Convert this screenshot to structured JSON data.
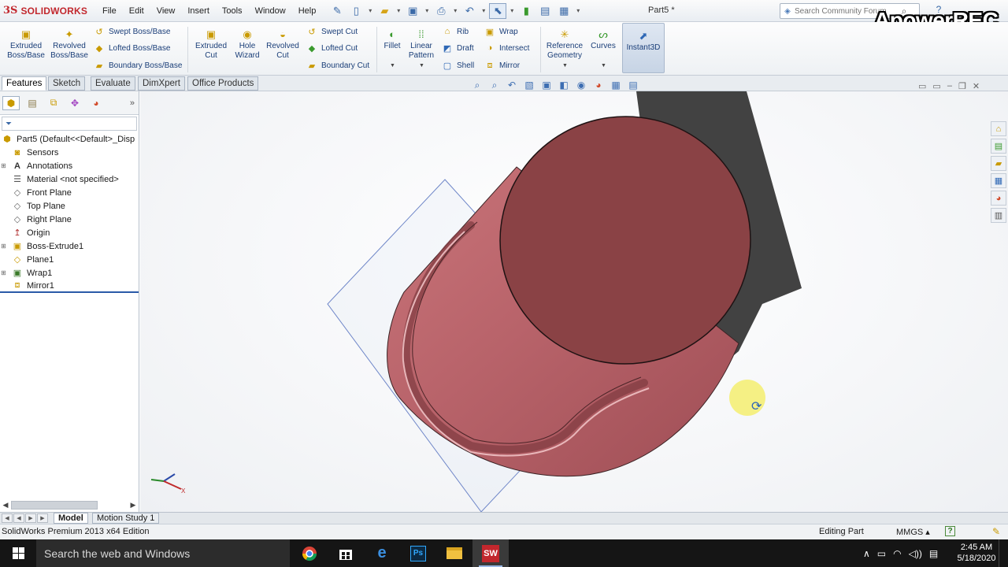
{
  "app": {
    "logo_ds": "3S",
    "logo_name": "SOLIDWORKS",
    "document_title": "Part5 *",
    "recorder_watermark": "ApowerREC s"
  },
  "menus": [
    "File",
    "Edit",
    "View",
    "Insert",
    "Tools",
    "Window",
    "Help"
  ],
  "search": {
    "placeholder": "Search Community Forum"
  },
  "ribbon": {
    "extruded_boss": "Extruded Boss/Base",
    "revolved_boss": "Revolved Boss/Base",
    "swept_boss": "Swept Boss/Base",
    "lofted_boss": "Lofted Boss/Base",
    "boundary_boss": "Boundary Boss/Base",
    "extruded_cut": "Extruded Cut",
    "hole_wizard": "Hole Wizard",
    "revolved_cut": "Revolved Cut",
    "swept_cut": "Swept Cut",
    "lofted_cut": "Lofted Cut",
    "boundary_cut": "Boundary Cut",
    "fillet": "Fillet",
    "linear_pattern": "Linear Pattern",
    "rib": "Rib",
    "draft": "Draft",
    "shell": "Shell",
    "wrap": "Wrap",
    "intersect": "Intersect",
    "mirror": "Mirror",
    "reference_geometry": "Reference Geometry",
    "curves": "Curves",
    "instant3d": "Instant3D"
  },
  "tabs": [
    "Features",
    "Sketch",
    "Evaluate",
    "DimXpert",
    "Office Products"
  ],
  "active_tab": "Features",
  "feature_tree": {
    "root": "Part5  (Default<<Default>_Disp",
    "items": [
      {
        "label": "Sensors",
        "icon": "sensor-icon",
        "expandable": false
      },
      {
        "label": "Annotations",
        "icon": "annotation-icon",
        "expandable": true
      },
      {
        "label": "Material <not specified>",
        "icon": "material-icon",
        "expandable": false
      },
      {
        "label": "Front Plane",
        "icon": "plane-icon",
        "expandable": false
      },
      {
        "label": "Top Plane",
        "icon": "plane-icon",
        "expandable": false
      },
      {
        "label": "Right Plane",
        "icon": "plane-icon",
        "expandable": false
      },
      {
        "label": "Origin",
        "icon": "origin-icon",
        "expandable": false
      },
      {
        "label": "Boss-Extrude1",
        "icon": "extrude-icon",
        "expandable": true
      },
      {
        "label": "Plane1",
        "icon": "plane-icon",
        "expandable": false
      },
      {
        "label": "Wrap1",
        "icon": "wrap-icon",
        "expandable": true
      },
      {
        "label": "Mirror1",
        "icon": "mirror-icon",
        "expandable": false
      }
    ]
  },
  "model_tabs": [
    "Model",
    "Motion Study 1"
  ],
  "status": {
    "edition": "SolidWorks Premium 2013 x64 Edition",
    "mode": "Editing Part",
    "units": "MMGS"
  },
  "taskbar": {
    "search_placeholder": "Search the web and Windows",
    "time": "2:45 AM",
    "date": "5/18/2020"
  },
  "colors": {
    "part_body": "#b8636a",
    "part_cap": "#8a4245",
    "brand_red": "#c2272d",
    "cursor_highlight": "#f5ef6e"
  }
}
